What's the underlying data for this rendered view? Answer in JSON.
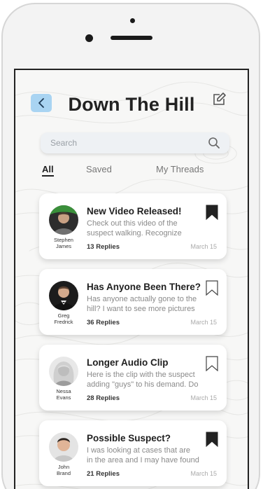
{
  "header": {
    "title": "Down The Hill"
  },
  "search": {
    "placeholder": "Search"
  },
  "tabs": [
    {
      "label": "All",
      "active": true
    },
    {
      "label": "Saved",
      "active": false
    },
    {
      "label": "My Threads",
      "active": false
    }
  ],
  "threads": [
    {
      "author_first": "Stephen",
      "author_last": "James",
      "title": "New Video Released!",
      "preview_line1": "Check out this video of the",
      "preview_line2": "suspect walking. Recognize",
      "replies": "13 Replies",
      "date": "March 15",
      "bookmarked": true
    },
    {
      "author_first": "Greg",
      "author_last": "Fredrick",
      "title": "Has Anyone Been There?",
      "preview_line1": "Has anyone actually gone to the",
      "preview_line2": "hill? I want to see more pictures",
      "replies": "36 Replies",
      "date": "March 15",
      "bookmarked": false
    },
    {
      "author_first": "Nessa",
      "author_last": "Evans",
      "title": "Longer Audio Clip",
      "preview_line1": "Here is the clip with the suspect",
      "preview_line2": "adding \"guys\" to his demand. Do",
      "replies": "28 Replies",
      "date": "March 15",
      "bookmarked": false
    },
    {
      "author_first": "John",
      "author_last": "Brand",
      "title": "Possible Suspect?",
      "preview_line1": "I was looking at cases that are",
      "preview_line2": "in the area and I may have found",
      "replies": "21 Replies",
      "date": "March 15",
      "bookmarked": true
    }
  ],
  "colors": {
    "back_button_bg": "#a9d4f2",
    "title_text": "#222222",
    "card_bg": "#ffffff",
    "bookmark": "#222222"
  }
}
